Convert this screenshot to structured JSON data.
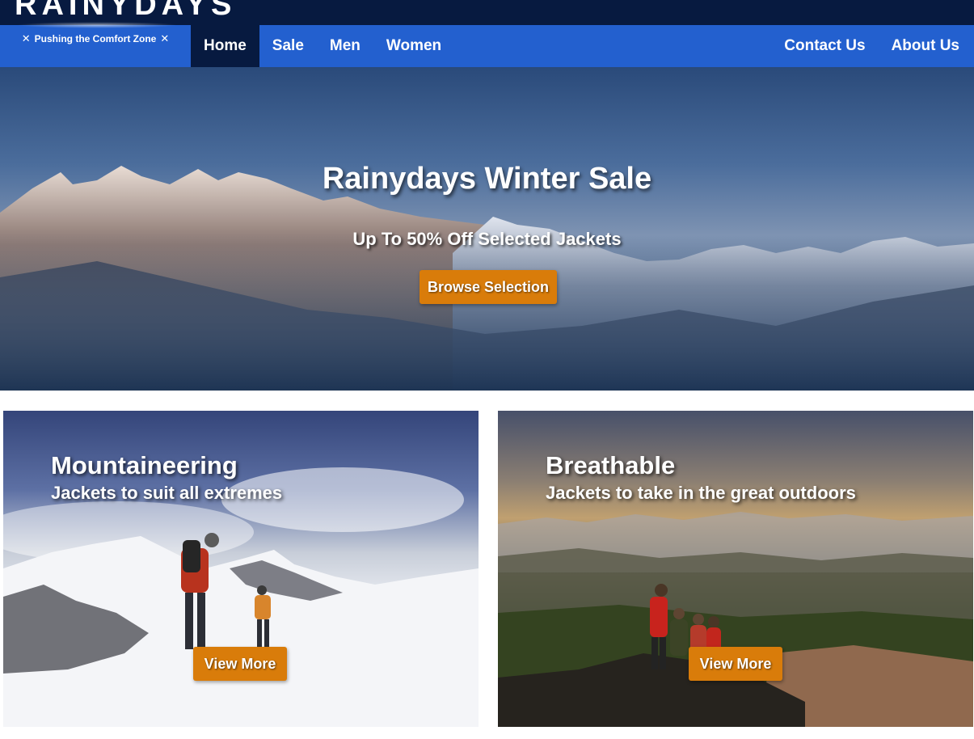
{
  "header": {
    "logo_text": "RAINYDAYS",
    "tagline": "Pushing the Comfort Zone",
    "tagline_icons": [
      "close-icon",
      "close-icon"
    ],
    "colors": {
      "topbar": "#071a40",
      "navbar": "#2360cf",
      "active": "#071a40"
    }
  },
  "nav": {
    "left": [
      "Home",
      "Sale",
      "Men",
      "Women"
    ],
    "right": [
      "Contact Us",
      "About Us"
    ],
    "active": "Home"
  },
  "hero": {
    "title": "Rainydays Winter Sale",
    "subtitle": "Up To 50% Off Selected Jackets",
    "button": "Browse Selection"
  },
  "cards": [
    {
      "title": "Mountaineering",
      "subtitle": "Jackets to suit all extremes",
      "button": "View More"
    },
    {
      "title": "Breathable",
      "subtitle": "Jackets to take in the great outdoors",
      "button": "View More"
    }
  ],
  "colors": {
    "button": "#d97c0a"
  }
}
